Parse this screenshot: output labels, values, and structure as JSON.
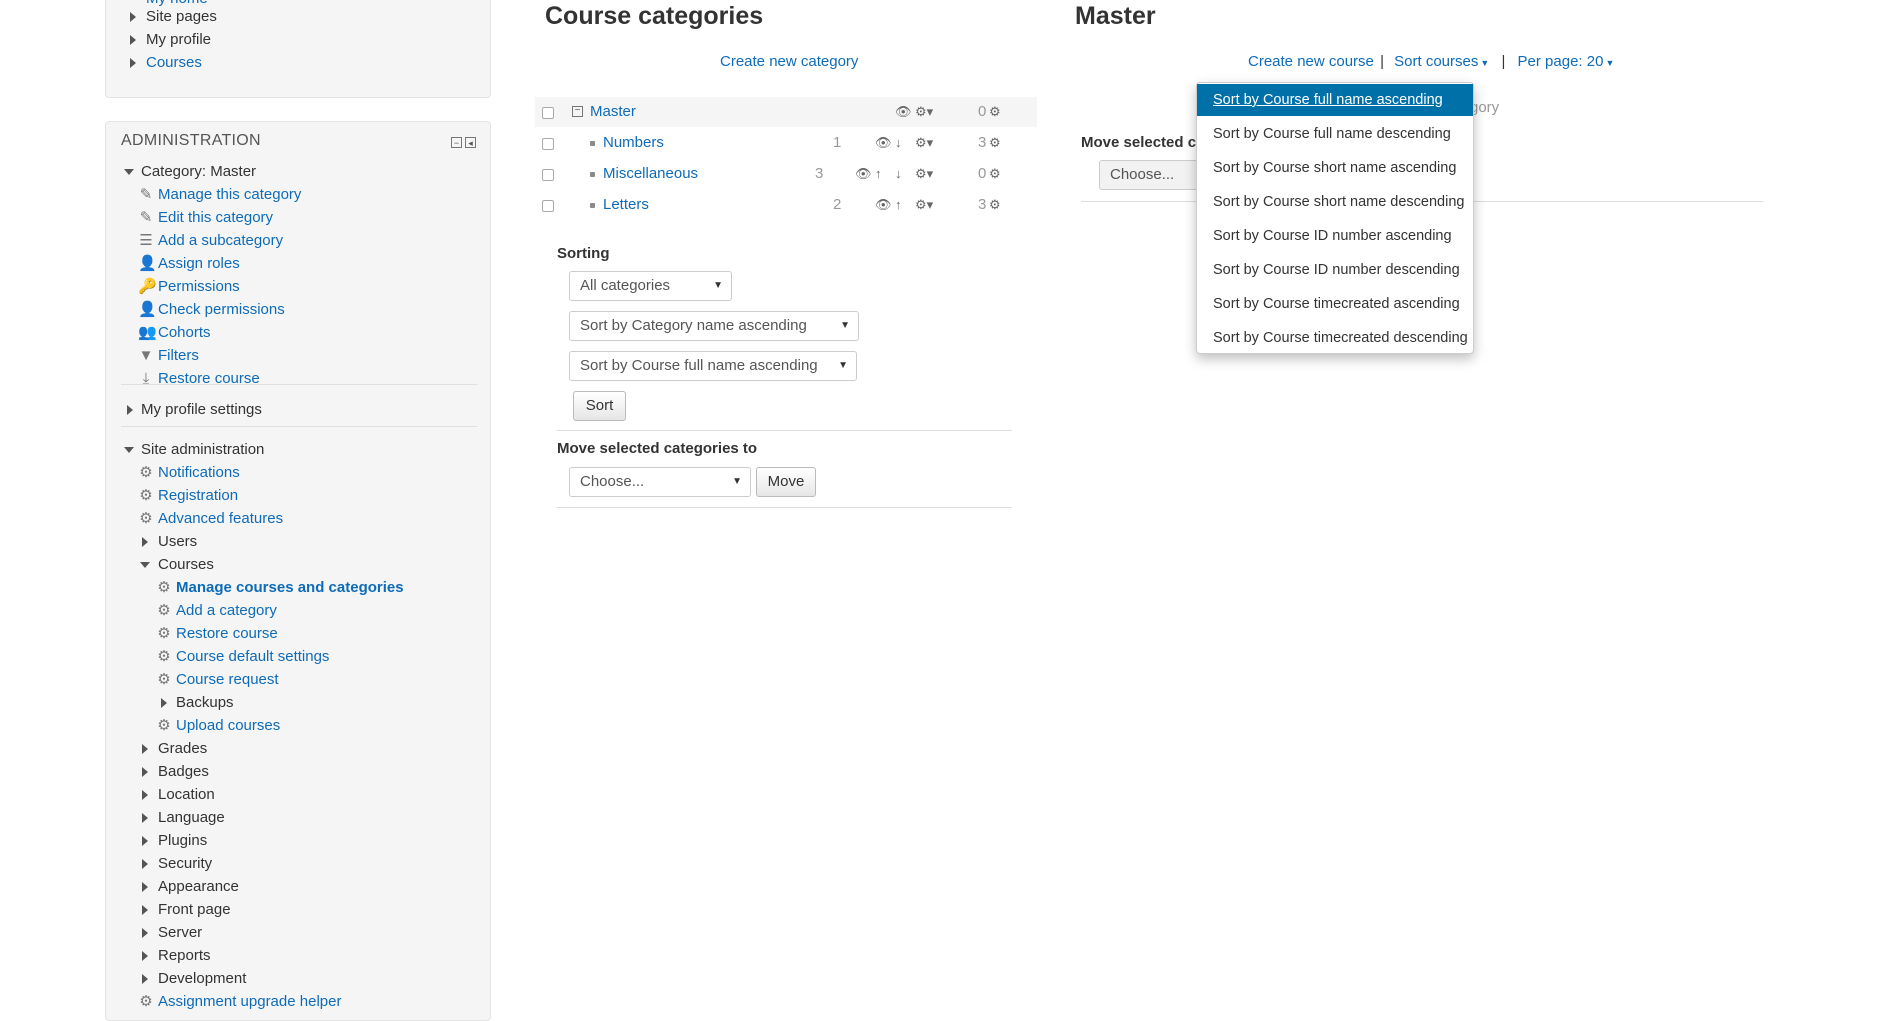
{
  "nav": {
    "items": [
      {
        "label": "My home",
        "link": true
      },
      {
        "label": "Site pages",
        "link": false
      },
      {
        "label": "My profile",
        "link": false
      },
      {
        "label": "Courses",
        "link": true
      }
    ]
  },
  "admin": {
    "title": "ADMINISTRATION",
    "category_label": "Category: Master",
    "category_items": [
      "Manage this category",
      "Edit this category",
      "Add a subcategory",
      "Assign roles",
      "Permissions",
      "Check permissions",
      "Cohorts",
      "Filters",
      "Restore course"
    ],
    "profile_settings": "My profile settings",
    "site_admin": "Site administration",
    "site_items": [
      "Notifications",
      "Registration",
      "Advanced features"
    ],
    "users": "Users",
    "courses": "Courses",
    "course_items": [
      "Manage courses and categories",
      "Add a category",
      "Restore course",
      "Course default settings",
      "Course request",
      "Backups",
      "Upload courses"
    ],
    "more_items": [
      "Grades",
      "Badges",
      "Location",
      "Language",
      "Plugins",
      "Security",
      "Appearance",
      "Front page",
      "Server",
      "Reports",
      "Development"
    ],
    "last_item": "Assignment upgrade helper"
  },
  "categories": {
    "title": "Course categories",
    "create_link": "Create new category",
    "rows": [
      {
        "name": "Master",
        "count": "",
        "courses": "0"
      },
      {
        "name": "Numbers",
        "count": "1",
        "courses": "3"
      },
      {
        "name": "Miscellaneous",
        "count": "3",
        "courses": "0"
      },
      {
        "name": "Letters",
        "count": "2",
        "courses": "3"
      }
    ],
    "sorting_label": "Sorting",
    "scope_select": "All categories",
    "category_sort_select": "Sort by Category name ascending",
    "course_sort_select": "Sort by Course full name ascending",
    "sort_button": "Sort",
    "move_label": "Move selected categories to",
    "move_select": "Choose...",
    "move_button": "Move"
  },
  "master": {
    "title": "Master",
    "create_course": "Create new course",
    "sep": "|",
    "sort_courses": "Sort courses",
    "per_page": "Per page: 20",
    "behind_text": "gory",
    "move_label": "Move selected c",
    "move_select": "Choose..."
  },
  "sort_menu": {
    "items": [
      "Sort by Course full name ascending",
      "Sort by Course full name descending",
      "Sort by Course short name ascending",
      "Sort by Course short name descending",
      "Sort by Course ID number ascending",
      "Sort by Course ID number descending",
      "Sort by Course timecreated ascending",
      "Sort by Course timecreated descending"
    ],
    "active_index": 0
  },
  "colors": {
    "link": "#0e6bb8",
    "menu_active": "#0070a8"
  }
}
